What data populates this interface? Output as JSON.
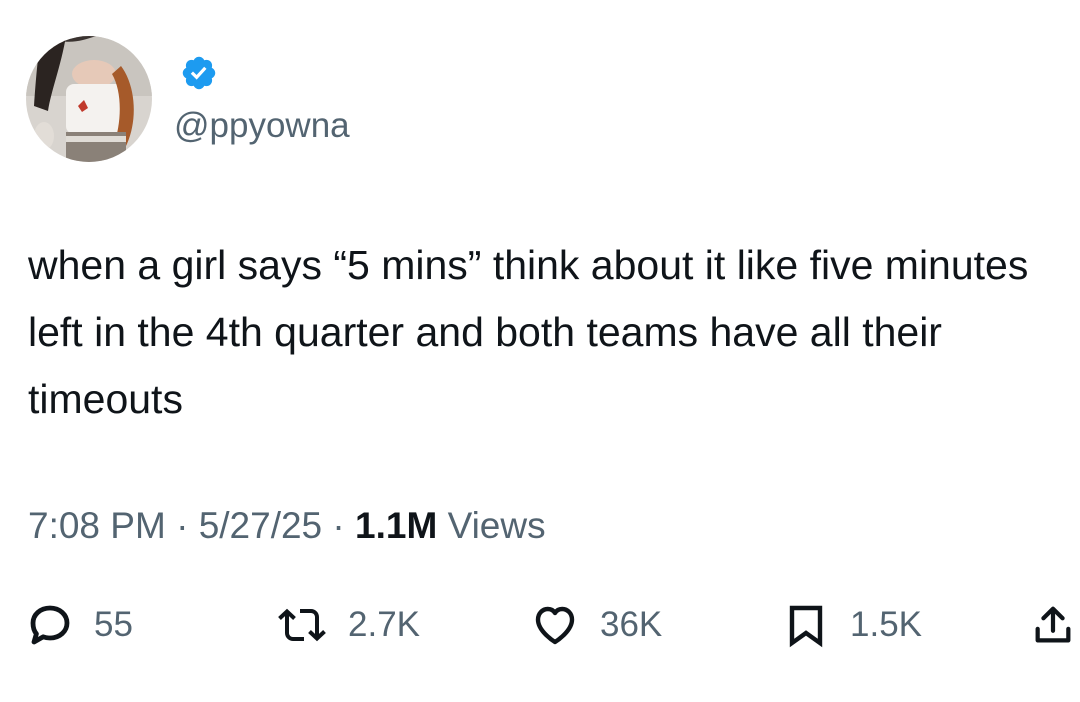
{
  "author": {
    "handle": "@ppyowna",
    "verified": true,
    "avatar": "profile-photo"
  },
  "tweet": {
    "text": "when a girl says “5 mins” think about it like five minutes left in the 4th quarter and both teams have all their timeouts"
  },
  "meta": {
    "time": "7:08 PM",
    "separator": "·",
    "date": "5/27/25",
    "views_count": "1.1M",
    "views_label": "Views"
  },
  "actions": {
    "replies": "55",
    "retweets": "2.7K",
    "likes": "36K",
    "bookmarks": "1.5K"
  },
  "colors": {
    "text_primary": "#0f1419",
    "text_secondary": "#536471",
    "verified_blue": "#1d9bf0"
  },
  "icons": [
    "reply-icon",
    "retweet-icon",
    "like-icon",
    "bookmark-icon",
    "share-icon",
    "verified-badge-icon"
  ]
}
